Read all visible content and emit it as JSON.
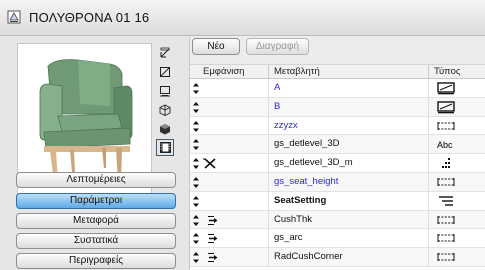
{
  "window": {
    "title": "ΠΟΛΥΘΡΟΝΑ 01 16"
  },
  "view_tools": [
    {
      "name": "side-view-icon"
    },
    {
      "name": "front-view-icon"
    },
    {
      "name": "plan-view-icon"
    },
    {
      "name": "axo-view-icon"
    },
    {
      "name": "shaded-view-icon"
    },
    {
      "name": "film-strip-icon",
      "active": true
    }
  ],
  "pages": [
    {
      "label": "Λεπτομέρειες"
    },
    {
      "label": "Παράμετροι",
      "active": true
    },
    {
      "label": "Μεταφορά"
    },
    {
      "label": "Συστατικά"
    },
    {
      "label": "Περιγραφείς"
    }
  ],
  "toolbar": {
    "new_label": "Νέο",
    "delete_label": "Διαγραφή"
  },
  "table": {
    "headers": {
      "show": "Εμφάνιση",
      "variable": "Μεταβλητή",
      "type": "Τύπος"
    },
    "rows": [
      {
        "variable": "A",
        "color": "blue",
        "show": "",
        "type": "length-icon"
      },
      {
        "variable": "B",
        "color": "blue",
        "show": "",
        "type": "length-icon"
      },
      {
        "variable": "zzyzx",
        "color": "blue",
        "show": "",
        "type": "dim-icon"
      },
      {
        "variable": "gs_detlevel_3D",
        "color": "black",
        "show": "",
        "type": "text-icon",
        "type_text": "Abc"
      },
      {
        "variable": "gs_detlevel_3D_m",
        "color": "black",
        "show": "hidden",
        "type": "integer-icon"
      },
      {
        "variable": "gs_seat_height",
        "color": "blue",
        "show": "",
        "type": "dim-icon"
      },
      {
        "variable": "SeatSetting",
        "color": "black",
        "bold": true,
        "show": "",
        "type": "title-icon"
      },
      {
        "variable": "CushThk",
        "color": "black",
        "show": "child",
        "type": "dim-icon"
      },
      {
        "variable": "gs_arc",
        "color": "black",
        "show": "child",
        "type": "dim-icon"
      },
      {
        "variable": "RadCushCorner",
        "color": "black",
        "show": "child",
        "type": "dim-icon"
      }
    ]
  }
}
